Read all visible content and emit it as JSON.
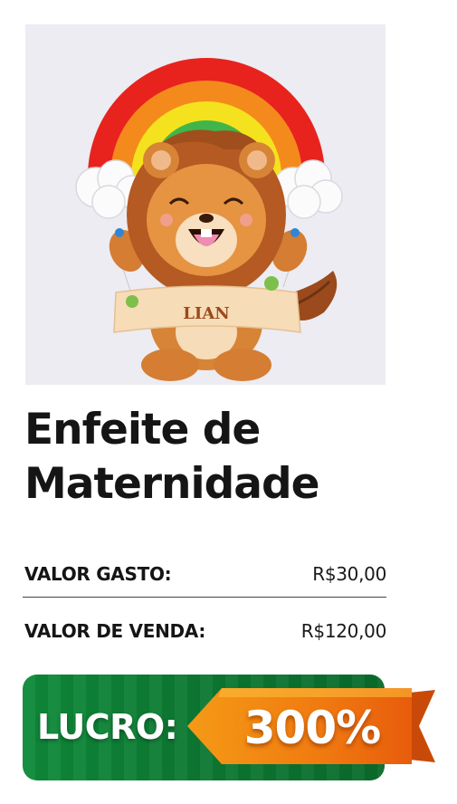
{
  "product": {
    "image_alt": "Enfeite de maternidade em feltro: leão com arco-íris",
    "name_tag": "LIAN",
    "title_line1": "Enfeite de",
    "title_line2": "Maternidade"
  },
  "pricing": {
    "cost_label": "VALOR GASTO:",
    "cost_value": "R$30,00",
    "sale_label": "VALOR DE VENDA:",
    "sale_value": "R$120,00"
  },
  "profit": {
    "label": "LUCRO:",
    "value": "300%"
  },
  "colors": {
    "profit_green": "#0d7a33",
    "ribbon_orange": "#f07a10",
    "title_text": "#151515"
  }
}
